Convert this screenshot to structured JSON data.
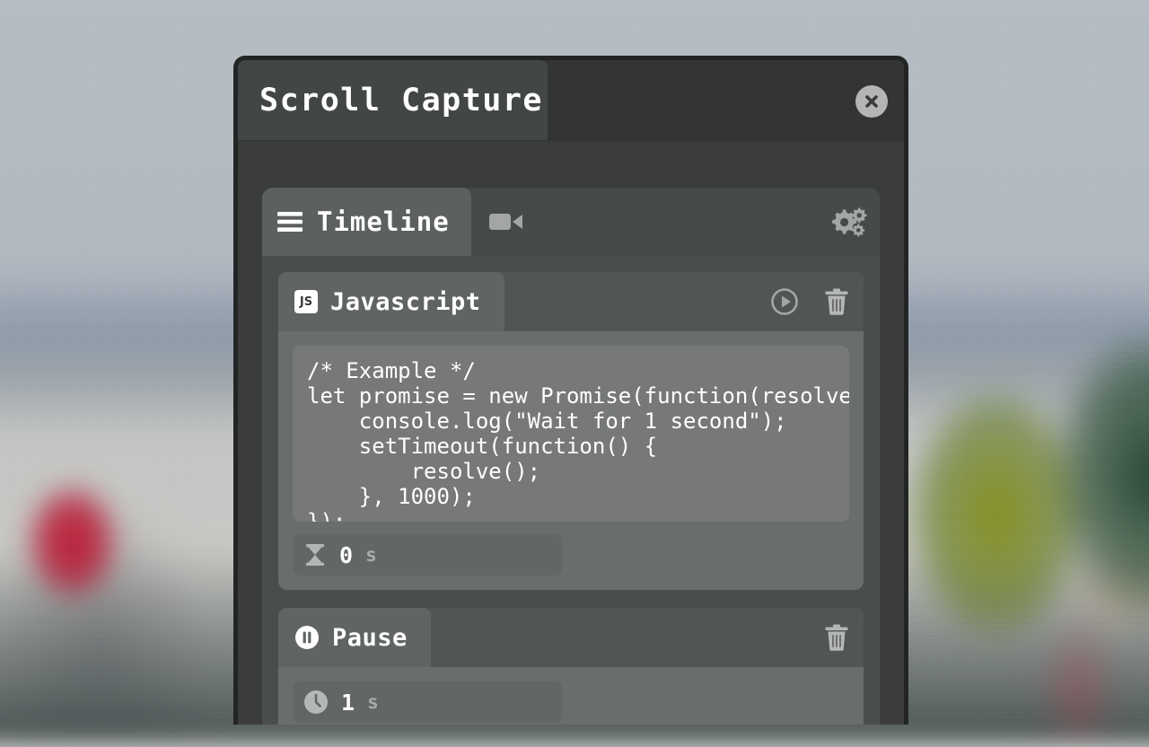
{
  "window": {
    "title": "Scroll Capture",
    "close_icon": "close-x-icon"
  },
  "tabs": [
    {
      "id": "timeline",
      "label": "Timeline",
      "icon": "hamburger-menu-icon",
      "active": true
    },
    {
      "id": "record",
      "label": "",
      "icon": "video-camera-icon",
      "active": false
    }
  ],
  "toolbar": {
    "settings_icon": "gears-settings-icon"
  },
  "panels": [
    {
      "id": "javascript",
      "title": "Javascript",
      "badge": "JS",
      "badge_icon": "js-badge-icon",
      "run_icon": "play-circle-icon",
      "delete_icon": "trash-icon",
      "code": "/* Example */\nlet promise = new Promise(function(resolve, reject) {\n    console.log(\"Wait for 1 second\");\n    setTimeout(function() {\n        resolve();\n    }, 1000);\n});",
      "duration": {
        "icon": "hourglass-icon",
        "value": "0",
        "unit": "s"
      }
    },
    {
      "id": "pause",
      "title": "Pause",
      "header_icon": "pause-circle-icon",
      "delete_icon": "trash-icon",
      "duration": {
        "icon": "clock-icon",
        "value": "1",
        "unit": "s"
      }
    }
  ],
  "colors": {
    "window_bg": "#3b3d3d",
    "window_border": "#232525",
    "titlebar": "#333535",
    "title_tab": "#434646",
    "card_bg": "#4a4d4d",
    "tab_active": "#5d6060",
    "panel_bg": "#6a6d6d",
    "panel_header": "#525555",
    "code_bg": "#767978",
    "text": "#ffffff",
    "muted_text": "#a9abab"
  }
}
